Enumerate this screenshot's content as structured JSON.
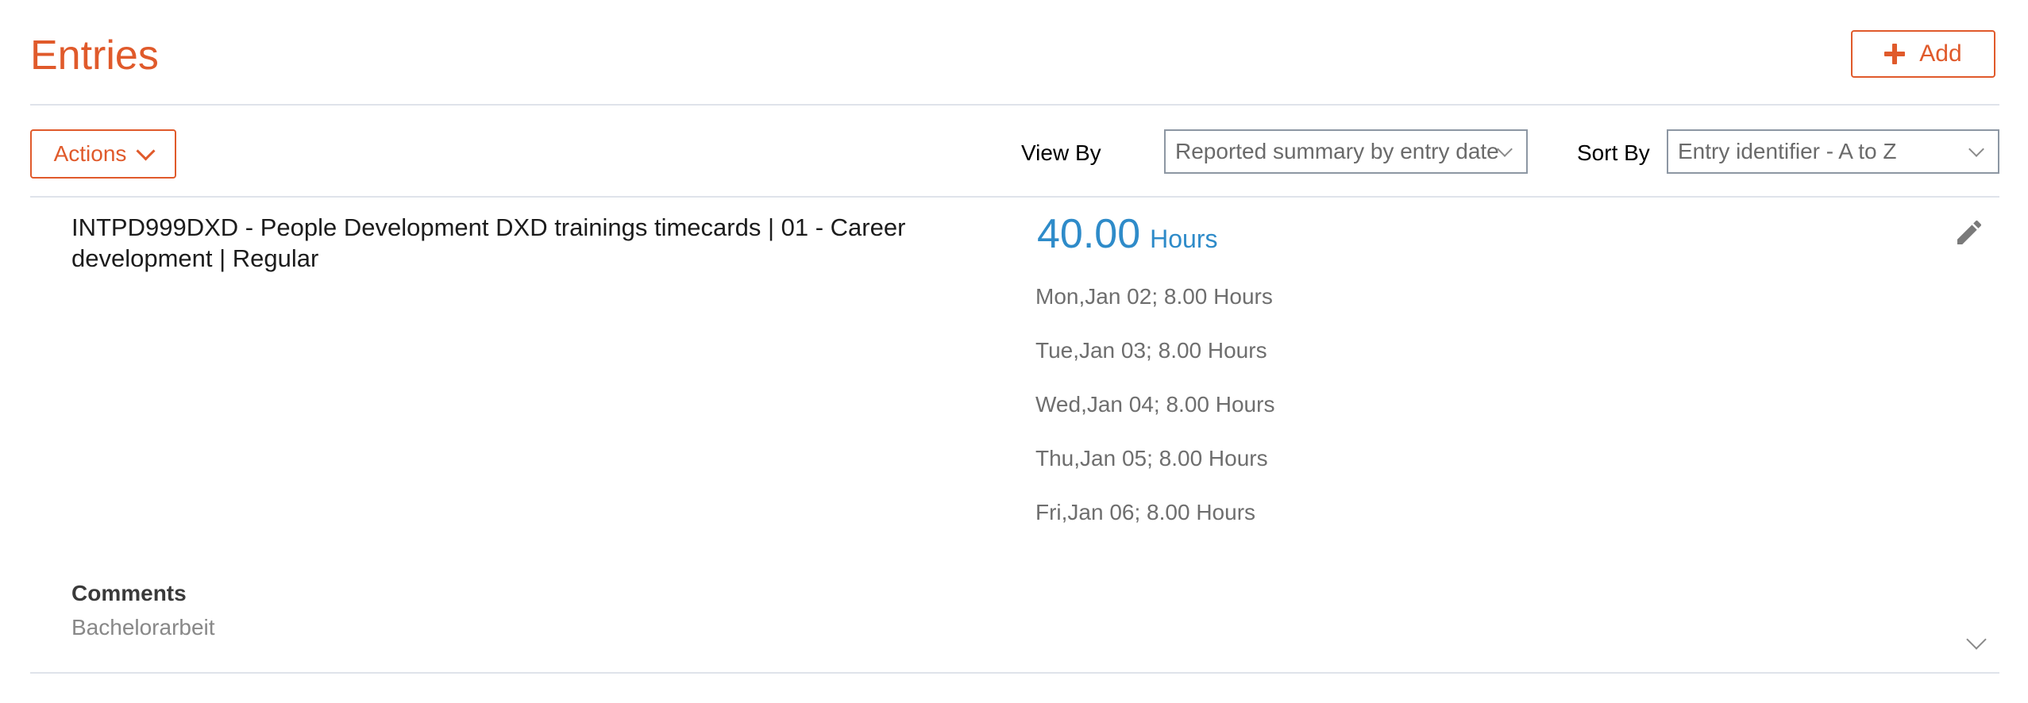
{
  "header": {
    "title": "Entries",
    "add_label": "Add"
  },
  "toolbar": {
    "actions_label": "Actions",
    "view_by_label": "View By",
    "view_by_value": "Reported summary by entry date",
    "sort_by_label": "Sort By",
    "sort_by_value": "Entry identifier - A to Z"
  },
  "entry": {
    "title": "INTPD999DXD - People Development DXD trainings timecards | 01 - Career development | Regular",
    "total_value": "40.00",
    "total_unit": "Hours",
    "days": [
      "Mon,Jan 02; 8.00 Hours",
      "Tue,Jan 03; 8.00 Hours",
      "Wed,Jan 04; 8.00 Hours",
      "Thu,Jan 05; 8.00 Hours",
      "Fri,Jan 06; 8.00 Hours"
    ],
    "comments_label": "Comments",
    "comments_value": "Bachelorarbeit"
  },
  "icons": {
    "add": "plus-icon",
    "actions": "chevron-down-icon",
    "edit": "pencil-icon",
    "expand": "chevron-down-icon"
  },
  "colors": {
    "accent": "#e05a2b",
    "hours_blue": "#2e8bc9",
    "divider": "#dfe3ea"
  }
}
